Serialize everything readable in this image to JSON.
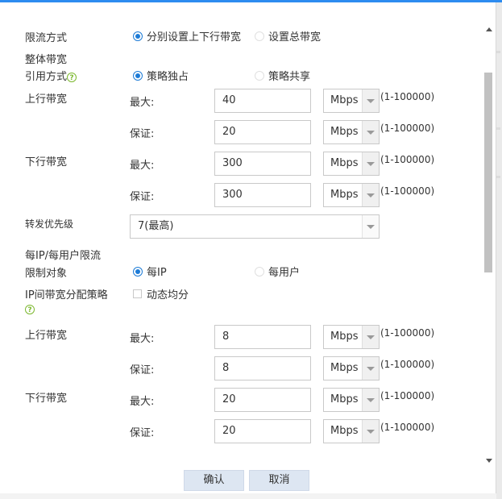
{
  "form": {
    "limit_mode": {
      "label": "限流方式",
      "options": [
        "分别设置上下行带宽",
        "设置总带宽"
      ],
      "selected": 0
    },
    "overall_section": "整体带宽",
    "ref_mode": {
      "label": "引用方式",
      "options": [
        "策略独占",
        "策略共享"
      ],
      "selected": 0
    },
    "up_bw": {
      "label": "上行带宽",
      "max_label": "最大:",
      "max_value": "40",
      "max_unit": "Mbps",
      "max_range": "(1-100000)",
      "min_label": "保证:",
      "min_value": "20",
      "min_unit": "Mbps",
      "min_range": "(1-100000)"
    },
    "down_bw": {
      "label": "下行带宽",
      "max_label": "最大:",
      "max_value": "300",
      "max_unit": "Mbps",
      "max_range": "(1-100000)",
      "min_label": "保证:",
      "min_value": "300",
      "min_unit": "Mbps",
      "min_range": "(1-100000)"
    },
    "priority": {
      "label": "转发优先级",
      "value": "7(最高)"
    },
    "per_section": "每IP/每用户限流",
    "limit_target": {
      "label": "限制对象",
      "options": [
        "每IP",
        "每用户"
      ],
      "selected": 0
    },
    "ip_policy": {
      "label": "IP间带宽分配策略",
      "checkbox_label": "动态均分",
      "checked": false
    },
    "per_up_bw": {
      "label": "上行带宽",
      "max_label": "最大:",
      "max_value": "8",
      "max_unit": "Mbps",
      "max_range": "(1-100000)",
      "min_label": "保证:",
      "min_value": "8",
      "min_unit": "Mbps",
      "min_range": "(1-100000)"
    },
    "per_down_bw": {
      "label": "下行带宽",
      "max_label": "最大:",
      "max_value": "20",
      "max_unit": "Mbps",
      "max_range": "(1-100000)",
      "min_label": "保证:",
      "min_value": "20",
      "min_unit": "Mbps",
      "min_range": "(1-100000)"
    }
  },
  "buttons": {
    "ok": "确认",
    "cancel": "取消"
  },
  "icons": {
    "help": "help-circle-icon"
  },
  "colors": {
    "accent": "#1d7bd6",
    "help": "#7cb82f",
    "button_bg": "#dde6f2"
  }
}
